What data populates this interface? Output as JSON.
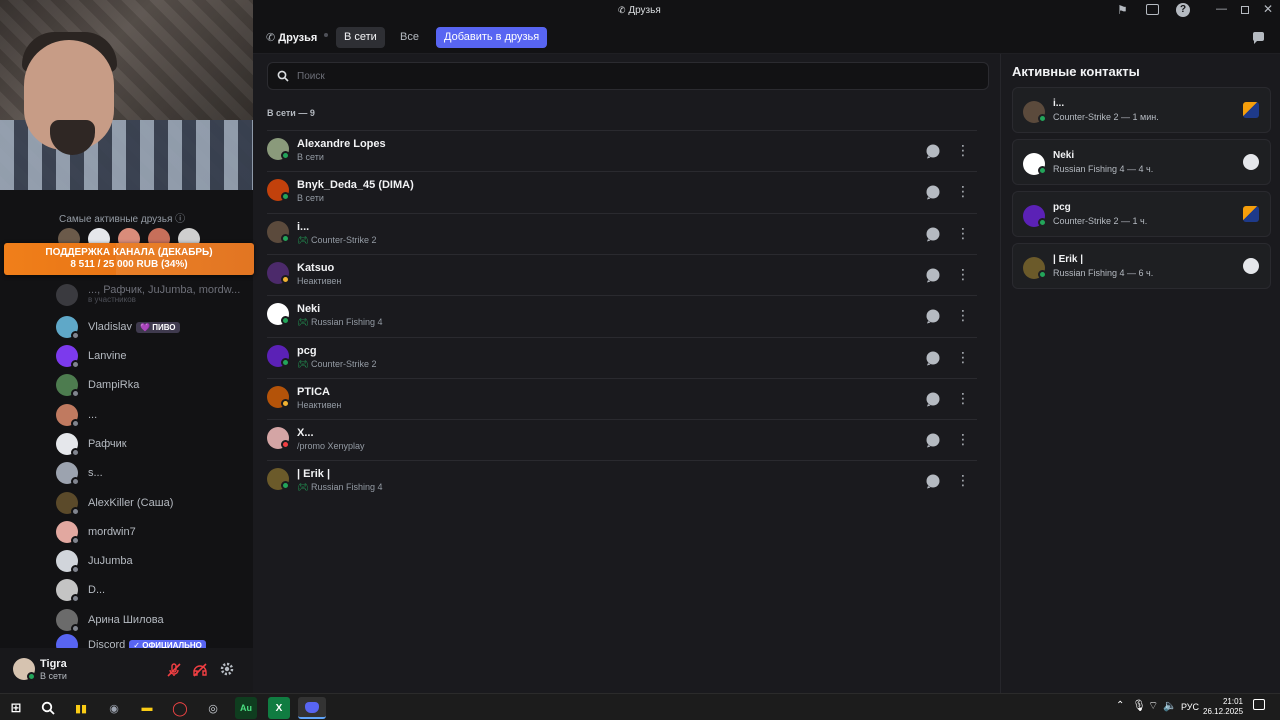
{
  "window": {
    "title": "Друзья"
  },
  "donation": {
    "line1": "ПОДДЕРЖКА КАНАЛА (ДЕКАБРЬ)",
    "line2": "8 511 / 25 000 RUB (34%)",
    "progress_percent": 34
  },
  "sidebar": {
    "active_friends_label": "Самые активные друзья",
    "group_dm": {
      "name": "..., Рафчик, JuJumba, mordw...",
      "sub": "в участников"
    },
    "items": [
      {
        "name": "Vladislav",
        "badge": "💜 ПИВО"
      },
      {
        "name": "Lanvine"
      },
      {
        "name": "DampiRka"
      },
      {
        "name": "..."
      },
      {
        "name": "Рафчик"
      },
      {
        "name": "s..."
      },
      {
        "name": "AlexKiller (Саша)"
      },
      {
        "name": "mordwin7"
      },
      {
        "name": "JuJumba"
      },
      {
        "name": "D..."
      },
      {
        "name": "Арина Шилова"
      },
      {
        "name": "Discord",
        "badge": "✓ ОФИЦИАЛЬНО"
      }
    ]
  },
  "user": {
    "name": "Tigra",
    "status": "В сети"
  },
  "toolbar": {
    "friends_label": "Друзья",
    "tab_online": "В сети",
    "tab_all": "Все",
    "add_friend": "Добавить в друзья"
  },
  "search": {
    "placeholder": "Поиск"
  },
  "list": {
    "header": "В сети — 9",
    "friends": [
      {
        "name": "Alexandre Lopes",
        "status": "В сети",
        "game": false,
        "state": "online",
        "color": "#8a9a7b"
      },
      {
        "name": "Bnyk_Deda_45 (DIMA)",
        "status": "В сети",
        "game": false,
        "state": "online",
        "color": "#c2410c"
      },
      {
        "name": "i...",
        "status": "Counter-Strike 2",
        "game": true,
        "state": "online",
        "color": "#5b4a3c"
      },
      {
        "name": "Katsuo",
        "status": "Неактивен",
        "game": false,
        "state": "idle",
        "color": "#4c2a6b"
      },
      {
        "name": "Neki",
        "status": "Russian Fishing 4",
        "game": true,
        "state": "online",
        "color": "#ffffff"
      },
      {
        "name": "pcg",
        "status": "Counter-Strike 2",
        "game": true,
        "state": "online",
        "color": "#5b21b6"
      },
      {
        "name": "PTICA",
        "status": "Неактивен",
        "game": false,
        "state": "idle",
        "color": "#b45309"
      },
      {
        "name": "X...",
        "status": "/promo Xenyplay",
        "game": false,
        "state": "dnd",
        "color": "#d4a5a5"
      },
      {
        "name": "| Erik |",
        "status": "Russian Fishing 4",
        "game": true,
        "state": "online",
        "color": "#6b5a2a"
      }
    ]
  },
  "active_contacts": {
    "title": "Активные контакты",
    "items": [
      {
        "name": "i...",
        "activity": "Counter-Strike 2 — 1 мин.",
        "color": "#5b4a3c",
        "game_icon": "cs2-icon"
      },
      {
        "name": "Neki",
        "activity": "Russian Fishing 4 — 4 ч.",
        "color": "#ffffff",
        "game_icon": "rf4-icon"
      },
      {
        "name": "pcg",
        "activity": "Counter-Strike 2 — 1 ч.",
        "color": "#5b21b6",
        "game_icon": "cs2-icon"
      },
      {
        "name": "| Erik |",
        "activity": "Russian Fishing 4 — 6 ч.",
        "color": "#6b5a2a",
        "game_icon": "rf4-icon"
      }
    ]
  },
  "tray": {
    "lang": "РУС",
    "time": "21:01",
    "date": "26.12.2025"
  },
  "colors": {
    "accent": "#5865f2",
    "online": "#23a55a",
    "idle": "#f0b232",
    "dnd": "#f23f43"
  }
}
